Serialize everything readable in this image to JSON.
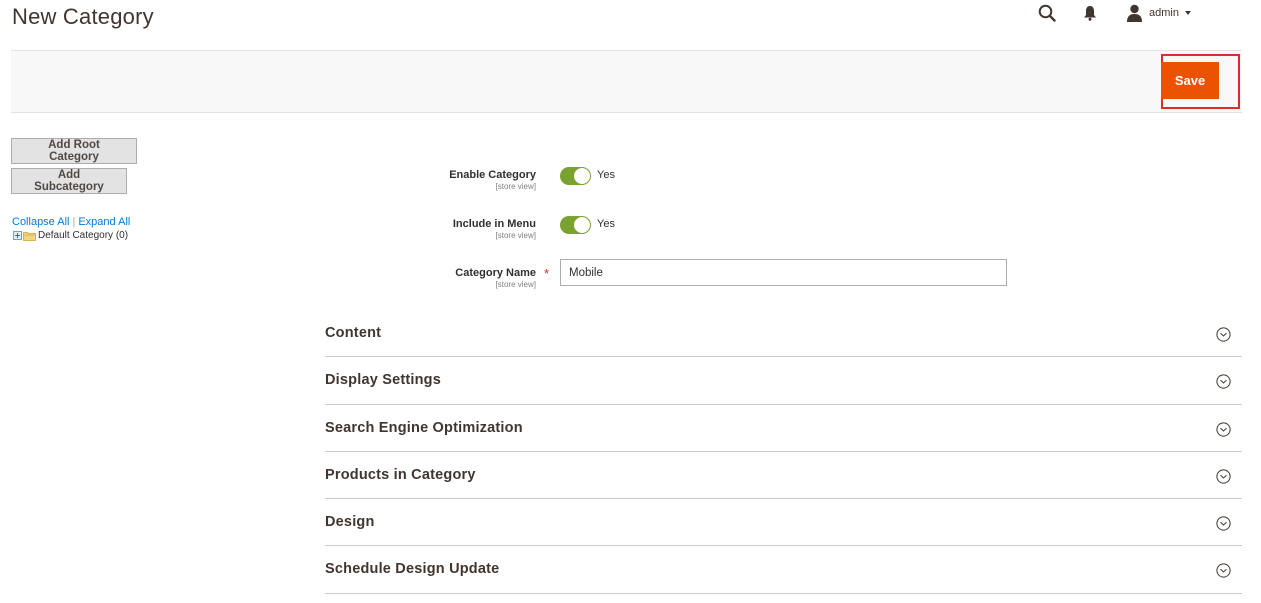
{
  "header": {
    "title": "New Category",
    "user": "admin",
    "icons": {
      "search": "search-icon",
      "notifications": "bell-icon",
      "user": "user-icon"
    }
  },
  "toolbar": {
    "save_label": "Save",
    "accent": "#eb5202",
    "highlight": "#e02b27"
  },
  "tree": {
    "add_root_label": "Add Root Category",
    "add_sub_label": "Add Subcategory",
    "collapse_all": "Collapse All",
    "separator": "|",
    "expand_all": "Expand All",
    "root_node": "Default Category (0)"
  },
  "form": {
    "enable_category": {
      "label": "Enable Category",
      "scope": "[store view]",
      "value": "Yes"
    },
    "include_in_menu": {
      "label": "Include in Menu",
      "scope": "[store view]",
      "value": "Yes"
    },
    "category_name": {
      "label": "Category Name",
      "scope": "[store view]",
      "required": "*",
      "value": "Mobile"
    },
    "toggle_color": "#79a22e"
  },
  "sections": [
    {
      "title": "Content"
    },
    {
      "title": "Display Settings"
    },
    {
      "title": "Search Engine Optimization"
    },
    {
      "title": "Products in Category"
    },
    {
      "title": "Design"
    },
    {
      "title": "Schedule Design Update"
    }
  ]
}
